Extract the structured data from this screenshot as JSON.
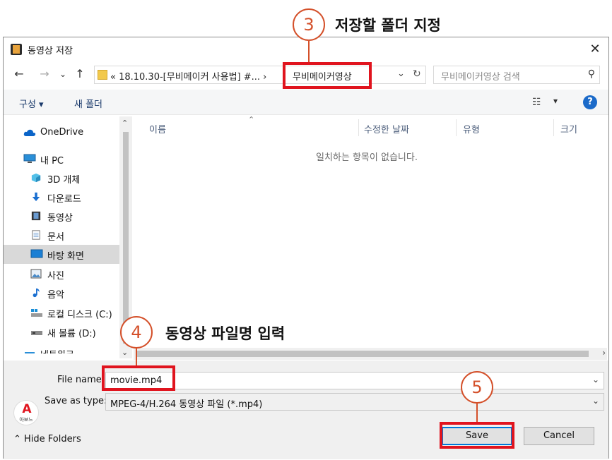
{
  "annotations": {
    "step3": {
      "num": "3",
      "label": "저장할 폴더 지정"
    },
    "step4": {
      "num": "4",
      "label": "동영상 파일명 입력"
    },
    "step5": {
      "num": "5"
    }
  },
  "dialog": {
    "title": "동영상 저장",
    "close": "✕"
  },
  "nav": {
    "back": "←",
    "forward": "→",
    "recent": "⌄",
    "up": "↑",
    "address_path": "«  18.10.30-[무비메이커 사용법] #...  ›",
    "address_current": "무비메이커영상",
    "address_dropdown": "⌄",
    "refresh": "↻",
    "search_placeholder": "무비메이커영상 검색",
    "search_icon": "⚲"
  },
  "toolbar": {
    "organize": "구성 ▾",
    "new_folder": "새 폴더",
    "view_icon": "☷",
    "view_dropdown": "▾",
    "help": "?"
  },
  "sidebar": {
    "items": [
      {
        "label": "OneDrive",
        "icon": "onedrive-icon"
      },
      {
        "label": "내 PC",
        "icon": "pc-icon"
      },
      {
        "label": "3D 개체",
        "icon": "3d-objects-icon"
      },
      {
        "label": "다운로드",
        "icon": "download-icon"
      },
      {
        "label": "동영상",
        "icon": "video-icon"
      },
      {
        "label": "문서",
        "icon": "document-icon"
      },
      {
        "label": "바탕 화면",
        "icon": "desktop-icon"
      },
      {
        "label": "사진",
        "icon": "pictures-icon"
      },
      {
        "label": "음악",
        "icon": "music-icon"
      },
      {
        "label": "로컬 디스크 (C:)",
        "icon": "local-disk-icon"
      },
      {
        "label": "새 볼륨 (D:)",
        "icon": "drive-icon"
      },
      {
        "label": "네트워크",
        "icon": "network-icon"
      }
    ],
    "scroll_up": "⌃",
    "scroll_down": "⌄"
  },
  "filelist": {
    "columns": [
      "이름",
      "수정한 날짜",
      "유형",
      "크기"
    ],
    "sort_arrow": "⌃",
    "empty_message": "일치하는 항목이 없습니다.",
    "scroll_right": "›"
  },
  "bottom": {
    "file_name_label": "File name:",
    "file_name_value": "movie.mp4",
    "save_as_type_label": "Save as type:",
    "save_as_type_value": "MPEG-4/H.264 동영상 파일 (*.mp4)",
    "chevron": "⌄",
    "hide_folders": "⌃  Hide Folders",
    "save": "Save",
    "cancel": "Cancel",
    "logo_letter": "A",
    "logo_text": "아보느"
  }
}
